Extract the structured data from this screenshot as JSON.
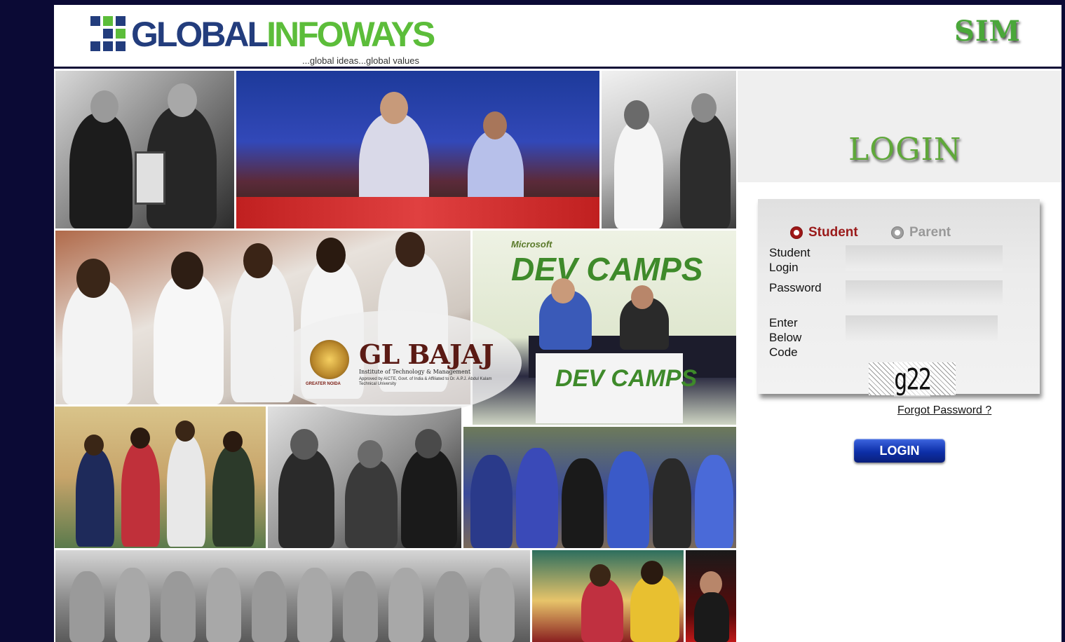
{
  "header": {
    "logo_name_part1": "GLOBAL",
    "logo_name_part2": "INFOWAYS",
    "logo_tagline": "...global ideas...global values",
    "module_badge": "SIM"
  },
  "collage": {
    "institute_badge": {
      "name": "GL BAJAJ",
      "subtitle": "Institute of Technology & Management",
      "approval": "Approved by AICTE, Govt. of India & Affiliated to Dr. A.P.J. Abdul Kalam Technical University",
      "city": "GREATER NOIDA"
    },
    "devcamps_banner": {
      "vendor": "Microsoft",
      "title": "DEV CAMPS"
    }
  },
  "login": {
    "title": "LOGIN",
    "user_type": {
      "student_label": "Student",
      "parent_label": "Parent",
      "selected": "Student"
    },
    "student_login_label": "Student Login",
    "password_label": "Password",
    "code_label": "Enter Below Code",
    "student_login_value": "",
    "password_value": "",
    "code_value": "",
    "captcha_text": "g22",
    "forgot_password_label": "Forgot Password ?",
    "submit_label": "LOGIN"
  },
  "colors": {
    "background": "#0b0a35",
    "brand_blue": "#233d7d",
    "brand_green": "#5cbd3a",
    "accent_red": "#a01818",
    "button_blue": "#0d2fa8"
  }
}
